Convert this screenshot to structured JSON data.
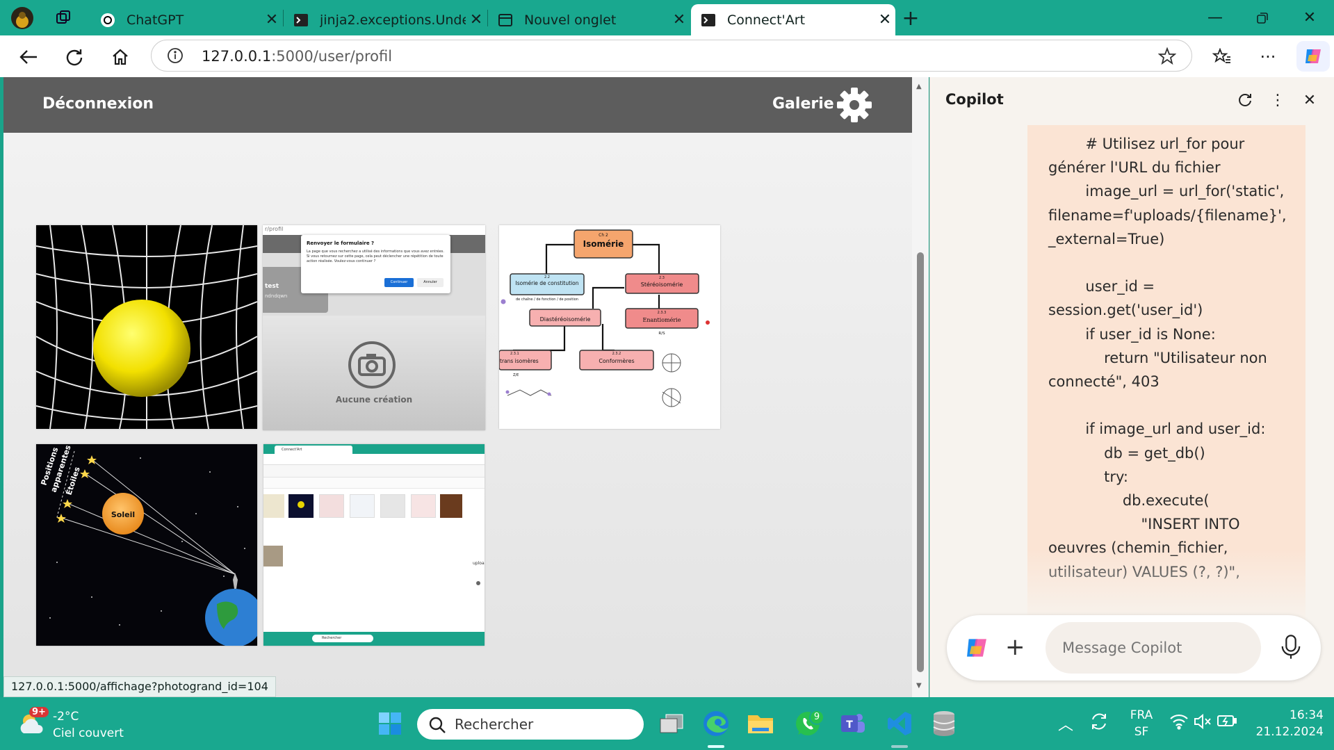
{
  "browser": {
    "tabs": [
      {
        "title": "ChatGPT",
        "active": false
      },
      {
        "title": "jinja2.exceptions.UndefinedError:",
        "active": false
      },
      {
        "title": "Nouvel onglet",
        "active": false
      },
      {
        "title": "Connect'Art",
        "active": true
      }
    ],
    "url_host": "127.0.0.1",
    "url_rest": ":5000/user/profil",
    "status_url": "127.0.0.1:5000/affichage?photogrand_id=104"
  },
  "page": {
    "logout_label": "Déconnexion",
    "gallery_label": "Galerie",
    "cards": {
      "dialog_title": "Renvoyer le formulaire ?",
      "dialog_body": "La page que vous recherchez a utilisé des informations que vous avez entrées. Si vous retournez sur cette page, cela peut déclencher une répétition de toute action réalisée. Voulez-vous continuer ?",
      "dialog_continue": "Continuer",
      "dialog_cancel": "Annuler",
      "profile_path": "r/profil",
      "profile_name": "test",
      "profile_sub": "ndndqwn",
      "no_creation": "Aucune création",
      "iso_ch": "Ch 2",
      "iso_title": "Isomérie",
      "iso_22_num": "2.2",
      "iso_22": "Isomérie de constitution",
      "iso_22_sub": "de chaîne / de fonction / de position",
      "iso_23_num": "2.3",
      "iso_23": "Stéréoisomérie",
      "iso_dia": "Diastéréoisomérie",
      "iso_233_num": "2.3.3",
      "iso_233": "Enantiomérie",
      "iso_rs": "R/S",
      "iso_231_num": "2.3.1",
      "iso_231": "trans isomères",
      "iso_ze": "Z/E",
      "iso_232_num": "2.3.2",
      "iso_232": "Conformères",
      "stars_label1": "Positions",
      "stars_label2": "apparentes",
      "stars_label3": "Étoiles",
      "sun_label": "Soleil",
      "shot_tab": "Connect'Art",
      "shot_upload": "uploa",
      "shot_search": "Rechercher"
    }
  },
  "copilot": {
    "title": "Copilot",
    "code_lines": [
      "        # Utilisez url_for pour générer l'URL du fichier",
      "        image_url = url_for('static', filename=f'uploads/{filename}', _external=True)",
      "",
      "        user_id = session.get('user_id')",
      "        if user_id is None:",
      "            return \"Utilisateur non connecté\", 403",
      "",
      "        if image_url and user_id:",
      "            db = get_db()",
      "            try:",
      "                db.execute(",
      "                    \"INSERT INTO oeuvres (chemin_fichier, utilisateur) VALUES (?, ?)\","
    ],
    "input_placeholder": "Message Copilot"
  },
  "taskbar": {
    "weather_badge": "9+",
    "temperature": "-2°C",
    "weather_desc": "Ciel couvert",
    "search_placeholder": "Rechercher",
    "whatsapp_badge": "9",
    "lang": "FRA",
    "lang_sub": "SF",
    "time": "16:34",
    "date": "21.12.2024"
  },
  "colors": {
    "accent": "#19a88f",
    "page_nav": "#5d5d5d",
    "copilot_bubble": "#fbe4d4"
  }
}
